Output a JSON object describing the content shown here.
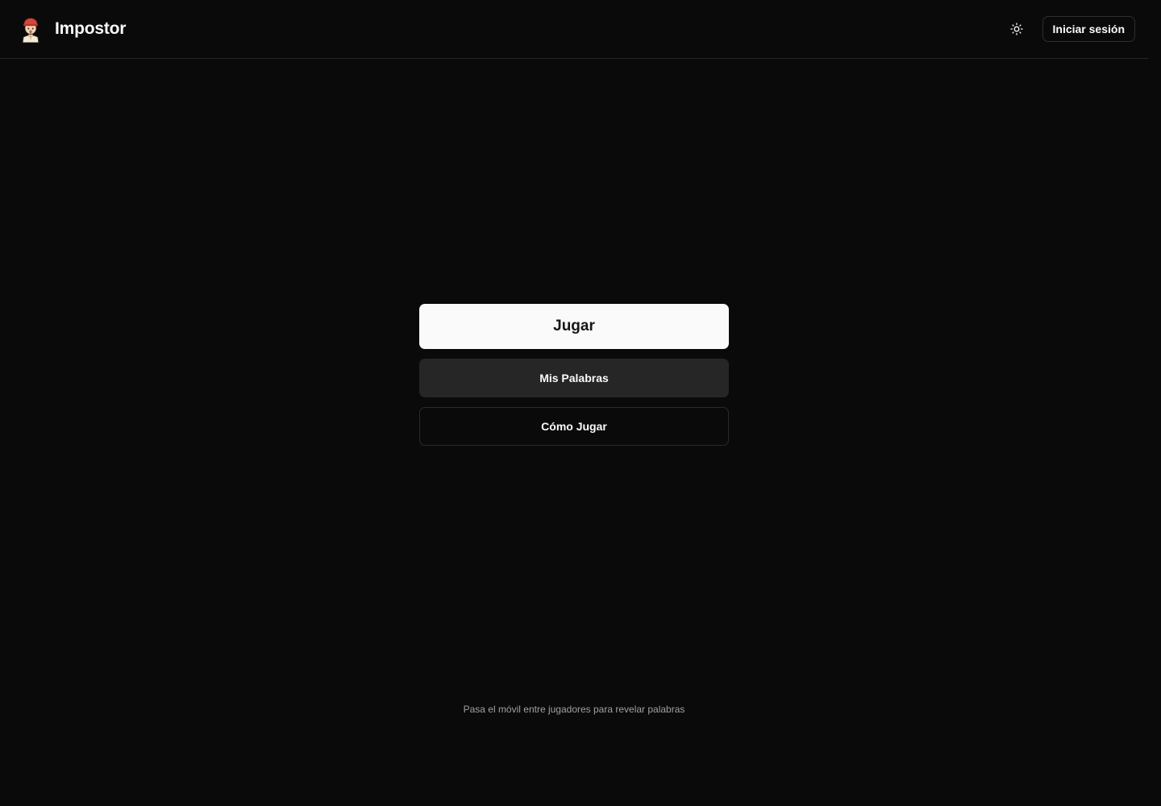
{
  "header": {
    "app_name": "Impostor",
    "logo_icon": "impostor-avatar-icon",
    "theme_toggle_icon": "sun-icon",
    "login_label": "Iniciar sesión"
  },
  "menu": {
    "play_label": "Jugar",
    "my_words_label": "Mis Palabras",
    "how_to_play_label": "Cómo Jugar"
  },
  "footer": {
    "hint": "Pasa el móvil entre jugadores para revelar palabras"
  },
  "colors": {
    "background": "#0a0a0a",
    "primary_button": "#fafafa",
    "secondary_button": "#262626",
    "border": "#262626",
    "muted_text": "#a1a1a1",
    "logo_hat": "#d9433a"
  }
}
